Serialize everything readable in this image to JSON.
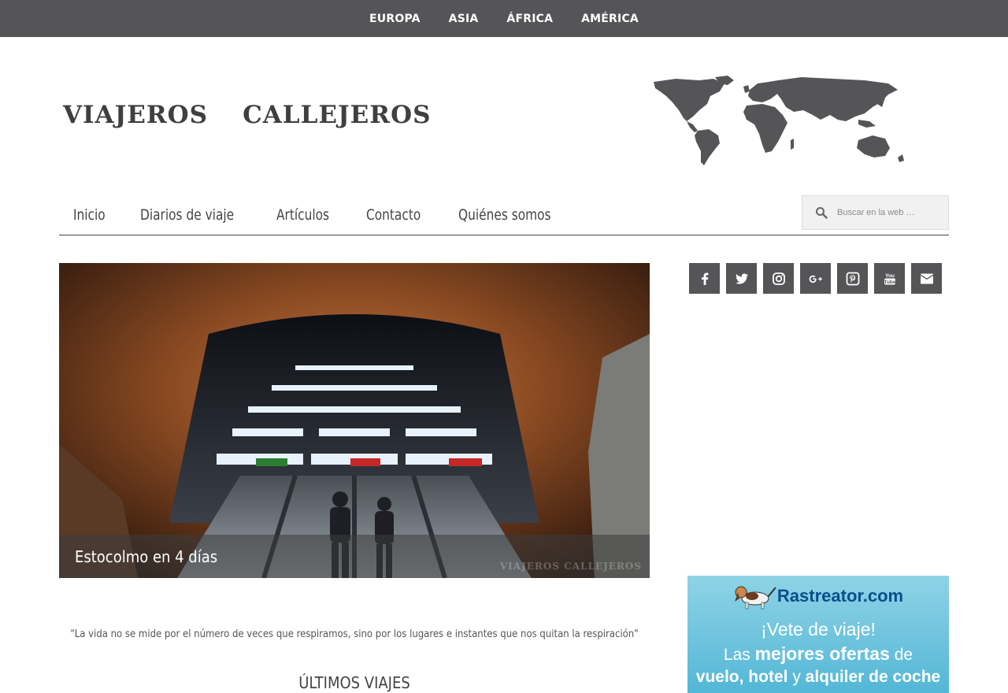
{
  "topnav": {
    "items": [
      "EUROPA",
      "ASIA",
      "ÁFRICA",
      "AMÉRICA"
    ]
  },
  "logo": {
    "left_word": "VIAJEROS",
    "right_word": "CALLEJEROS"
  },
  "mainnav": {
    "items": [
      "Inicio",
      "Diarios de viaje",
      "Artículos",
      "Contacto",
      "Quiénes somos"
    ]
  },
  "search": {
    "placeholder": "Buscar en la web …"
  },
  "hero": {
    "caption": "Estocolmo en 4 días",
    "watermark": "VIAJEROS CALLEJEROS"
  },
  "quote": "\"La vida no se mide por el número de veces que respiramos, sino por los lugares e instantes que nos quitan la respiración\"",
  "section_title": "ÚLTIMOS VIAJES",
  "social": {
    "icons": [
      "facebook-icon",
      "twitter-icon",
      "instagram-icon",
      "google-plus-icon",
      "pinterest-icon",
      "youtube-icon",
      "email-icon"
    ]
  },
  "ad": {
    "brand": "Rastreator.com",
    "line1": "¡Vete de viaje!",
    "line2_pre": "Las",
    "line2_bold": "mejores ofertas",
    "line2_post": "de",
    "line3_a": "vuelo, hotel",
    "line3_b": "y",
    "line3_c": "alquiler de coche"
  },
  "colors": {
    "topbar": "#555558",
    "text": "#444444",
    "ad_brand": "#0a4f8a",
    "ad_bg": "#53b7d6"
  }
}
